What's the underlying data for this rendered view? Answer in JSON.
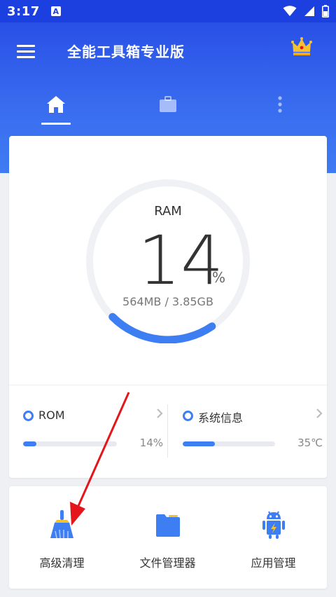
{
  "status_bar": {
    "time": "3:17",
    "notification_icon": "a-icon",
    "icons": [
      "wifi-icon",
      "cellular-icon",
      "battery-icon"
    ]
  },
  "app": {
    "title": "全能工具箱专业版",
    "menu_icon": "menu-icon",
    "premium_icon": "crown-icon"
  },
  "tabs": [
    {
      "icon": "home-icon",
      "selected": true
    },
    {
      "icon": "briefcase-icon",
      "selected": false
    },
    {
      "icon": "more-vert-icon",
      "selected": false
    }
  ],
  "ram": {
    "label": "RAM",
    "percent": "14",
    "percent_sign": "%",
    "detail": "564MB / 3.85GB",
    "fill_fraction": 0.14
  },
  "stats": {
    "rom": {
      "label": "ROM",
      "value": "14%",
      "fill_fraction": 0.14
    },
    "system": {
      "label": "系统信息",
      "value": "35℃",
      "fill_fraction": 0.35
    }
  },
  "tools": [
    {
      "label": "高级清理",
      "icon": "broom-icon"
    },
    {
      "label": "文件管理器",
      "icon": "folder-icon"
    },
    {
      "label": "应用管理",
      "icon": "android-icon"
    }
  ],
  "colors": {
    "status_bar": "#1c3fe0",
    "header_start": "#2950e6",
    "header_end": "#3f7bf2",
    "accent": "#3d7ef2",
    "annotation_arrow": "#e4161c",
    "crown": "#f6c131",
    "folder": "#3d7ef2",
    "battery_bolt": "#f6c131"
  },
  "annotation": {
    "type": "arrow",
    "target": "advanced-clean-tool"
  }
}
